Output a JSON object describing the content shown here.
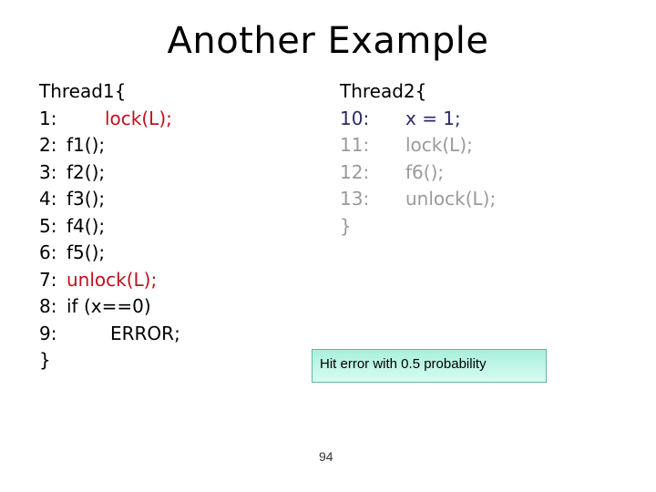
{
  "title": "Another Example",
  "thread1": {
    "header": "Thread1{",
    "lines": [
      {
        "num": "1:",
        "code": "lock(L);",
        "color": "red"
      },
      {
        "num": "2:",
        "code": "f1();",
        "color": "black"
      },
      {
        "num": "3:",
        "code": "f2();",
        "color": "black"
      },
      {
        "num": "4:",
        "code": "f3();",
        "color": "black"
      },
      {
        "num": "5:",
        "code": "f4();",
        "color": "black"
      },
      {
        "num": "6:",
        "code": "f5();",
        "color": "black"
      },
      {
        "num": "7:",
        "code": "unlock(L);",
        "color": "red"
      },
      {
        "num": "8:",
        "code": "if (x==0)",
        "color": "black"
      },
      {
        "num": "9:",
        "code": "ERROR;",
        "color": "black"
      }
    ],
    "footer": "}"
  },
  "thread2": {
    "header": "Thread2{",
    "lines": [
      {
        "num": "10:",
        "code": "x = 1;",
        "color": "navy"
      },
      {
        "num": "11:",
        "code": "lock(L);",
        "color": "grey"
      },
      {
        "num": "12:",
        "code": "f6();",
        "color": "grey"
      },
      {
        "num": "13:",
        "code": "unlock(L);",
        "color": "grey"
      }
    ],
    "footer": "}"
  },
  "callout": "Hit error with 0.5 probability",
  "page_number": "94",
  "colors": {
    "highlight_red": "#c0101e",
    "executed_navy": "#2b2b62",
    "pending_grey": "#9a9a9a",
    "callout_fill": "#c0f6e6",
    "callout_border": "#5fb8a4"
  }
}
